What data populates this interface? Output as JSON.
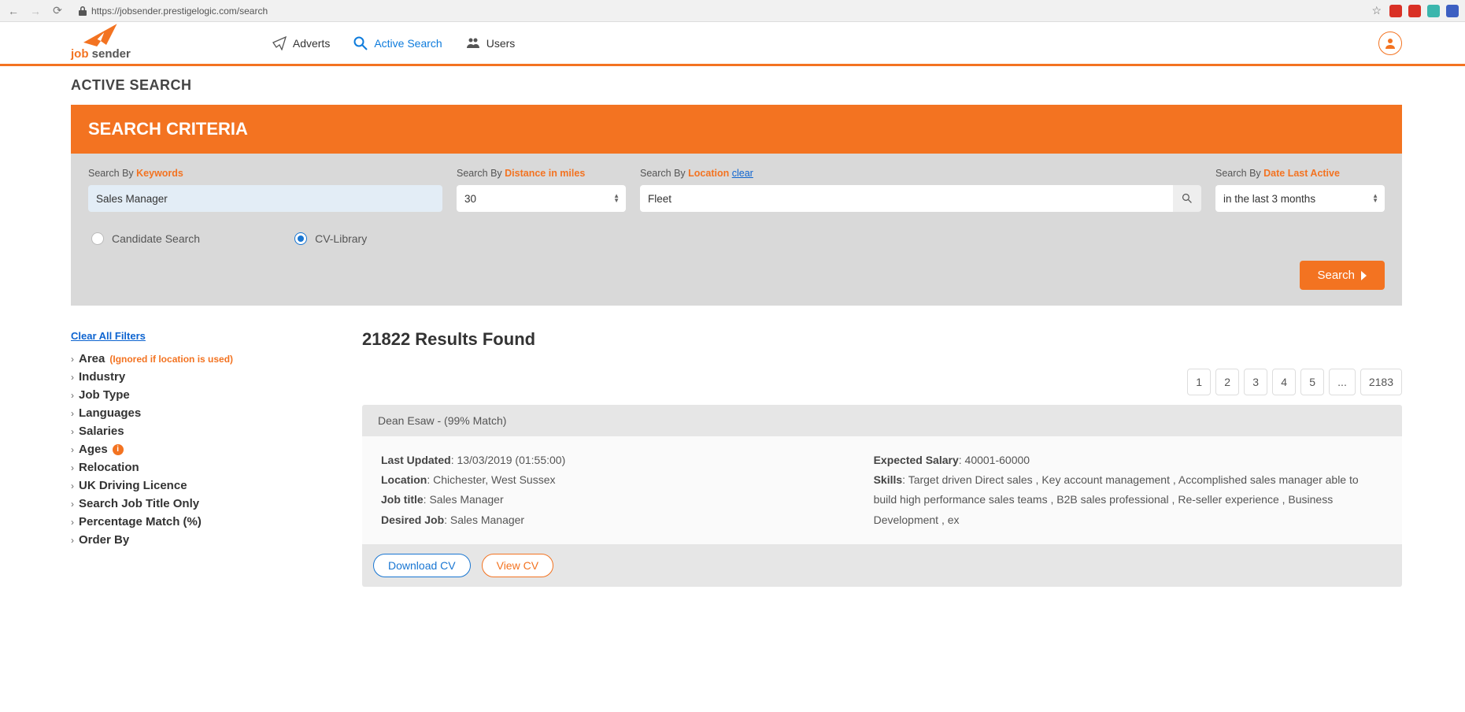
{
  "browser": {
    "url": "https://jobsender.prestigelogic.com/search"
  },
  "nav": {
    "brand1": "job",
    "brand2": " sender",
    "items": [
      {
        "label": "Adverts"
      },
      {
        "label": "Active Search"
      },
      {
        "label": "Users"
      }
    ]
  },
  "page_title": "ACTIVE SEARCH",
  "criteria": {
    "panel_title": "SEARCH CRITERIA",
    "labels": {
      "search_by": "Search By ",
      "keywords": "Keywords",
      "distance": "Distance in miles",
      "location": "Location",
      "clear": "clear",
      "date_last_active": "Date Last Active"
    },
    "keywords_value": "Sales Manager",
    "distance_value": "30",
    "location_value": "Fleet",
    "date_value": "in the last 3 months",
    "radio": {
      "candidate": "Candidate Search",
      "cvlibrary": "CV-Library"
    },
    "search_btn": "Search"
  },
  "filters": {
    "clear_all": "Clear All Filters",
    "area_note": "(Ignored if location is used)",
    "items": [
      "Area",
      "Industry",
      "Job Type",
      "Languages",
      "Salaries",
      "Ages",
      "Relocation",
      "UK Driving Licence",
      "Search Job Title Only",
      "Percentage Match (%)",
      "Order By"
    ]
  },
  "results": {
    "heading": "21822 Results Found",
    "pages": [
      "1",
      "2",
      "3",
      "4",
      "5",
      "...",
      "2183"
    ],
    "card": {
      "title": "Dean Esaw - (99% Match)",
      "labels": {
        "last_updated": "Last Updated",
        "location": "Location",
        "job_title": "Job title",
        "desired_job": "Desired Job",
        "expected_salary": "Expected Salary",
        "skills": "Skills"
      },
      "last_updated": ": 13/03/2019 (01:55:00)",
      "location": ": Chichester, West Sussex",
      "job_title": ": Sales Manager",
      "desired_job": ": Sales Manager",
      "expected_salary": ": 40001-60000",
      "skills": ": Target driven Direct sales , Key account management , Accomplished sales manager able to build high performance sales teams , B2B sales professional , Re-seller experience , Business Development , ex",
      "download_cv": "Download CV",
      "view_cv": "View CV"
    }
  }
}
